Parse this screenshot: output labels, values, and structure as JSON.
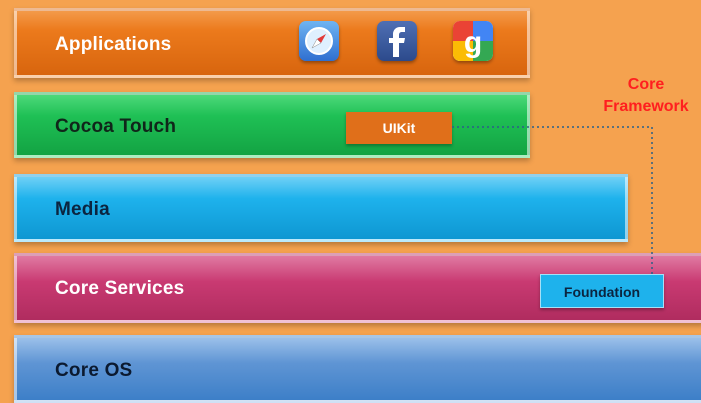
{
  "layers": [
    {
      "label": "Applications",
      "color": "#ec7a1c"
    },
    {
      "label": "Cocoa Touch",
      "color": "#1fc055"
    },
    {
      "label": "Media",
      "color": "#1eb2ec"
    },
    {
      "label": "Core Services",
      "color": "#c93a72"
    },
    {
      "label": "Core OS",
      "color": "#3d7fc8"
    }
  ],
  "app_icons": [
    "safari-icon",
    "facebook-icon",
    "google-icon"
  ],
  "uikit": {
    "label": "UIKit",
    "color": "#e06f1a"
  },
  "foundation": {
    "label": "Foundation",
    "color": "#1eb2ec"
  },
  "core_framework": {
    "line1": "Core",
    "line2": "Framework",
    "color": "#ff1f1f"
  }
}
